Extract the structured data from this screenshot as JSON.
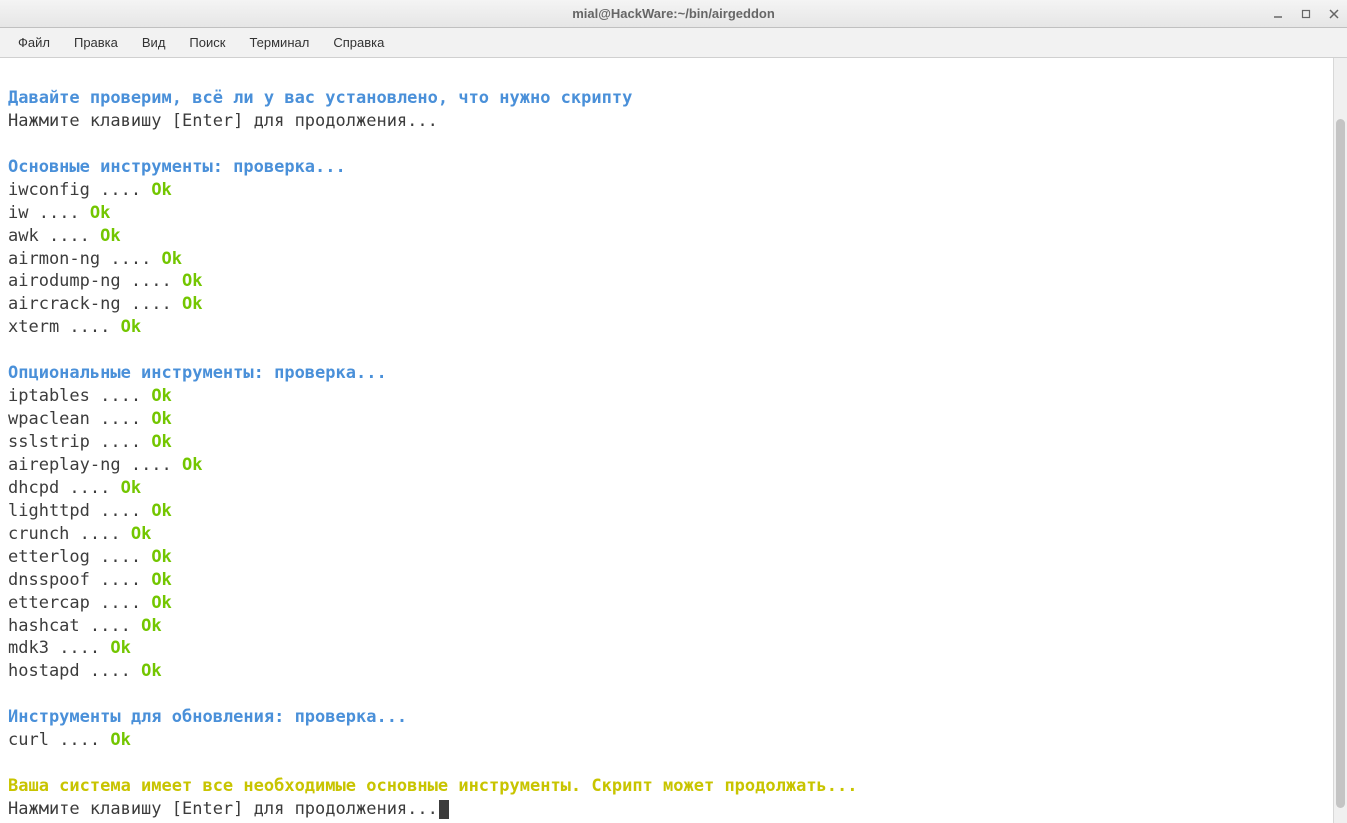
{
  "window": {
    "title": "mial@HackWare:~/bin/airgeddon"
  },
  "menu": {
    "file": "Файл",
    "edit": "Правка",
    "view": "Вид",
    "search": "Поиск",
    "terminal": "Терминал",
    "help": "Справка"
  },
  "headers": {
    "intro": "Давайте проверим, всё ли у вас установлено, что нужно скрипту",
    "essential": "Основные инструменты: проверка...",
    "optional": "Опциональные инструменты: проверка...",
    "update": "Инструменты для обновления: проверка...",
    "success": "Ваша система имеет все необходимые основные инструменты. Скрипт может продолжать..."
  },
  "prompt": "Нажмите клавишу [Enter] для продолжения...",
  "dots": " .... ",
  "ok": "Ok",
  "essential_tools": [
    "iwconfig",
    "iw",
    "awk",
    "airmon-ng",
    "airodump-ng",
    "aircrack-ng",
    "xterm"
  ],
  "optional_tools": [
    "iptables",
    "wpaclean",
    "sslstrip",
    "aireplay-ng",
    "dhcpd",
    "lighttpd",
    "crunch",
    "etterlog",
    "dnsspoof",
    "ettercap",
    "hashcat",
    "mdk3",
    "hostapd"
  ],
  "update_tools": [
    "curl"
  ]
}
